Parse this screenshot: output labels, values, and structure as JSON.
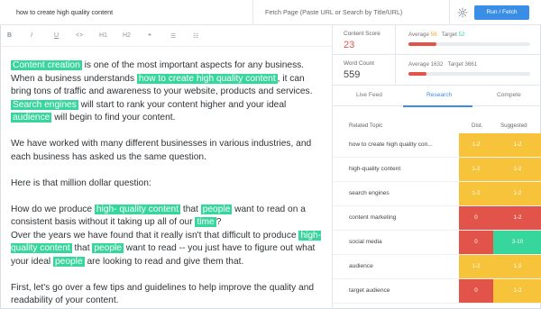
{
  "colors": {
    "accent": "#3a8ee6",
    "highlight": "#37d69c",
    "red": "#e2534a",
    "yellow": "#f6c33a",
    "green": "#37d69c"
  },
  "topbar": {
    "query": "how to create high quality content",
    "fetch_placeholder": "Fetch Page (Paste URL or Search by Title/URL)",
    "settings_icon": "gear-icon",
    "run_label": "Run / Fetch"
  },
  "toolbar": {
    "bold": "B",
    "italic": "I",
    "underline": "U",
    "code": "<>",
    "h1": "H1",
    "h2": "H2",
    "quote": "❝",
    "bullets": "☰",
    "numbers": "☷"
  },
  "editor": {
    "p1": {
      "hl_content_creation": "Content creation",
      "t1": " is one of the most important aspects for any business. When a business understands ",
      "hl_how_to": "how to  create high quality  content",
      "t2": ", it can bring tons of traffic and awareness to your website, products and services. ",
      "hl_search_engines": "Search engines",
      "t3": " will start to rank your content higher and your ideal ",
      "hl_audience": "audience",
      "t4": " will begin to find your content."
    },
    "p2": "We have worked with many different businesses in various industries, and each business has asked us the same question.",
    "p3": "Here is that million dollar question:",
    "p4": {
      "t1": "How do we produce ",
      "hl_hq1": "high-  quality content",
      "t2": " that ",
      "hl_people1": "people",
      "t3": " want to read on a consistent basis without it taking up all of our ",
      "hl_time": "time",
      "t4": "?",
      "t5": "Over the years we have found that it really isn't that difficult to produce ",
      "hl_hq2": "high-  quality content",
      "t6": " that ",
      "hl_people2": "people",
      "t7": " want to read -- you just have to figure out what your ideal ",
      "hl_people3": "people",
      "t8": " are looking to read and give them that."
    },
    "p5": "First, let's go over a few tips and guidelines to help improve the quality and readability of your content."
  },
  "metrics": {
    "score_label": "Content Score",
    "score_value": "23",
    "score_avg_label": "Average",
    "score_avg": "56",
    "score_target_label": "Target",
    "score_target": "52",
    "score_fill": 0.23,
    "wc_label": "Word Count",
    "wc_value": "559",
    "wc_avg_label": "Average",
    "wc_avg": "1632",
    "wc_target_label": "Target",
    "wc_target": "3661",
    "wc_fill": 0.15
  },
  "tabs": {
    "live": "Live Feed",
    "research": "Research",
    "compete": "Compete"
  },
  "table": {
    "headers": {
      "topic": "Related Topic",
      "dist": "Dist.",
      "suggested": "Suggested"
    },
    "rows": [
      {
        "topic": "how to create high quality con...",
        "dist": "1-2",
        "sugg": "1-2",
        "dist_color": "#f6c33a",
        "sugg_color": "#f6c33a"
      },
      {
        "topic": "high-quality content",
        "dist": "1-2",
        "sugg": "1-2",
        "dist_color": "#f6c33a",
        "sugg_color": "#f6c33a"
      },
      {
        "topic": "search engines",
        "dist": "1-2",
        "sugg": "1-2",
        "dist_color": "#f6c33a",
        "sugg_color": "#f6c33a"
      },
      {
        "topic": "content marketing",
        "dist": "0",
        "sugg": "1-2",
        "dist_color": "#e2534a",
        "sugg_color": "#e2534a"
      },
      {
        "topic": "social media",
        "dist": "0",
        "sugg": "3-10",
        "dist_color": "#e2534a",
        "sugg_color": "#37d69c"
      },
      {
        "topic": "audience",
        "dist": "1-2",
        "sugg": "1-2",
        "dist_color": "#f6c33a",
        "sugg_color": "#f6c33a"
      },
      {
        "topic": "target audience",
        "dist": "0",
        "sugg": "1-2",
        "dist_color": "#e2534a",
        "sugg_color": "#f6c33a"
      }
    ]
  }
}
